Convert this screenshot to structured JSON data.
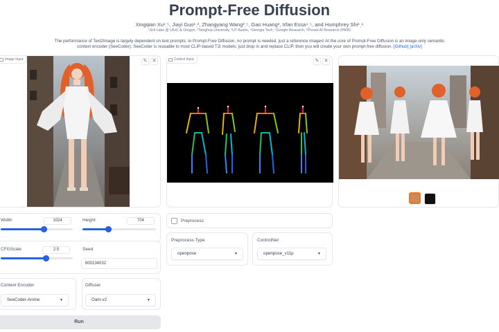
{
  "header": {
    "title": "Prompt-Free Diffusion",
    "authors": "Xingqian Xu¹ˏ⁵, Jiayi Guo¹ˏ², Zhangyang Wang³ˏ⁵, Gao Huang², Irfan Essa⁴ˏ⁵, and Humphrey Shi¹ˏ⁶",
    "affiliations": "¹SHI Labs @ UIUC & Oregon, ²Tsinghua University, ³UT Austin, ⁴Georgia Tech, ⁵Google Research, ⁶Picsart AI Research (PAIR)",
    "abstract": "The performance of Text2Image is largely dependent on text prompts. In Prompt-Free Diffusion, no prompt is needed, just a reference images! At the core of Prompt-Free Diffusion is an image-only semantic context encoder (SeeCoder). SeeCoder is reusable to most CLIP-based T2I models: just drop in and replace CLIP, then you will create your own prompt-free diffusion.",
    "github_link": "[Github]",
    "arxiv_link": "[arXiv]"
  },
  "image_input": {
    "label": "Image Input"
  },
  "control_input": {
    "label": "Control Input"
  },
  "icons": {
    "edit": "✎",
    "close": "✕"
  },
  "controls": {
    "width": {
      "label": "Width",
      "value": "1024",
      "min": 256,
      "max": 1536,
      "current": 1024
    },
    "height": {
      "label": "Height",
      "value": "704",
      "min": 256,
      "max": 1536,
      "current": 704
    },
    "cfg_scale": {
      "label": "CFGScale",
      "value": "2.5",
      "min": 0,
      "max": 4,
      "current": 2.5
    },
    "seed": {
      "label": "Seed",
      "value": "800134032"
    },
    "context_encoder": {
      "label": "Context Encoder",
      "selected": "SeeCoder-Anime"
    },
    "diffuser": {
      "label": "Diffuser",
      "selected": "Oam-v2"
    },
    "preprocess": {
      "label": "Preprocess",
      "checked": false
    },
    "preprocess_type": {
      "label": "Preprocess Type",
      "selected": "openpose"
    },
    "controlnet": {
      "label": "ControlNet",
      "selected": "openpose_v11p"
    }
  },
  "run_button": "Run",
  "colors": {
    "accent": "#2563eb",
    "border": "#e5e7eb",
    "button": "#e5e7eb",
    "hair": "#e0622a"
  }
}
